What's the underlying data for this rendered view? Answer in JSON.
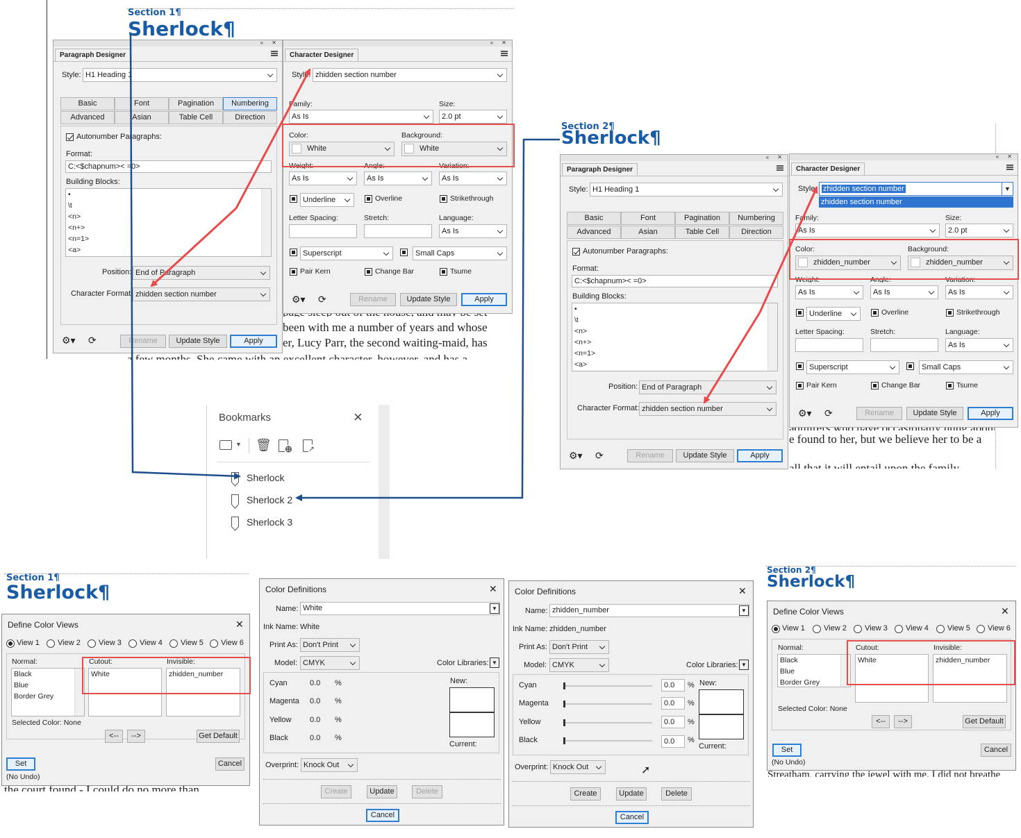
{
  "headings": {
    "section1": "Section 1¶",
    "section2": "Section 2¶",
    "sherlock": "Sherlock¶"
  },
  "body_text": {
    "l1": "page sleep out of the house, and may be set",
    "l2": "been with me a number of years and whose",
    "l3": "er, Lucy Parr, the second waiting-maid, has",
    "l4": "a few months. She came with an excellent character, however, and has a",
    "r1": "admirers who have occasionally hung about",
    "r2": "e found to her, but we believe her to be a",
    "r3": "all that it will entail upon the family",
    "bl": "the court found - I could do no more than",
    "br": "Streatham, carrying the jewel with me. I did not breathe"
  },
  "pd": {
    "title": "Paragraph Designer",
    "style_label": "Style:",
    "style_value": "H1 Heading 1",
    "tabs": [
      "Basic",
      "Font",
      "Pagination",
      "Numbering",
      "Advanced",
      "Asian",
      "Table Cell",
      "Direction"
    ],
    "autonumber": "Autonumber Paragraphs:",
    "format_label": "Format:",
    "format_value": "C:<$chapnum>< =0>",
    "blocks_label": "Building Blocks:",
    "blocks": [
      "•",
      "\\t",
      "<n>",
      "<n+>",
      "<n=1>",
      "<a>"
    ],
    "position_label": "Position:",
    "position_value": "End of Paragraph",
    "charformat_label": "Character Format:",
    "charformat_value": "zhidden section number",
    "rename": "Rename",
    "update": "Update Style",
    "apply": "Apply"
  },
  "cd": {
    "title": "Character Designer",
    "style_label": "Style:",
    "style_value": "zhidden section number",
    "family_label": "Family:",
    "family_value": "As Is",
    "size_label": "Size:",
    "size_value": "2.0 pt",
    "color_label": "Color:",
    "bg_label": "Background:",
    "color1": "White",
    "color2": "zhidden_number",
    "weight_label": "Weight:",
    "angle_label": "Angle:",
    "variation_label": "Variation:",
    "as_is": "As Is",
    "underline": "Underline",
    "overline": "Overline",
    "strikethrough": "Strikethrough",
    "letterspacing": "Letter Spacing:",
    "stretch": "Stretch:",
    "language": "Language:",
    "superscript": "Superscript",
    "smallcaps": "Small Caps",
    "pairkern": "Pair Kern",
    "changebar": "Change Bar",
    "tsume": "Tsume",
    "rename": "Rename",
    "update": "Update Style",
    "apply": "Apply",
    "dropdown_option": "zhidden section number"
  },
  "bookmarks": {
    "title": "Bookmarks",
    "items": [
      "Sherlock",
      "Sherlock 2",
      "Sherlock 3"
    ]
  },
  "dcv": {
    "title": "Define Color Views",
    "views": [
      "View 1",
      "View 2",
      "View 3",
      "View 4",
      "View 5",
      "View 6"
    ],
    "normal": "Normal:",
    "cutout": "Cutout:",
    "invisible": "Invisible:",
    "normal_items": [
      "Black",
      "Blue",
      "Border Grey"
    ],
    "cutout_item": "White",
    "invisible_item": "zhidden_number",
    "selected": "Selected Color: None",
    "left": "<--",
    "right": "-->",
    "get_default": "Get Default",
    "set": "Set",
    "no_undo": "(No Undo)",
    "cancel": "Cancel"
  },
  "cdef": {
    "title": "Color Definitions",
    "name_label": "Name:",
    "ink_label": "Ink Name:",
    "name1": "White",
    "name2": "zhidden_number",
    "printas_label": "Print As:",
    "printas_value": "Don't Print",
    "model_label": "Model:",
    "model_value": "CMYK",
    "libraries": "Color Libraries:",
    "channels": [
      "Cyan",
      "Magenta",
      "Yellow",
      "Black"
    ],
    "value": "0.0",
    "pct": "%",
    "new": "New:",
    "current": "Current:",
    "overprint_label": "Overprint:",
    "overprint_value": "Knock Out",
    "create": "Create",
    "update": "Update",
    "delete": "Delete",
    "cancel": "Cancel"
  },
  "colors": {
    "accent_red": "#e74c4c",
    "arrow_blue": "#1f4e8c",
    "heading_blue": "#1a5ba6"
  }
}
